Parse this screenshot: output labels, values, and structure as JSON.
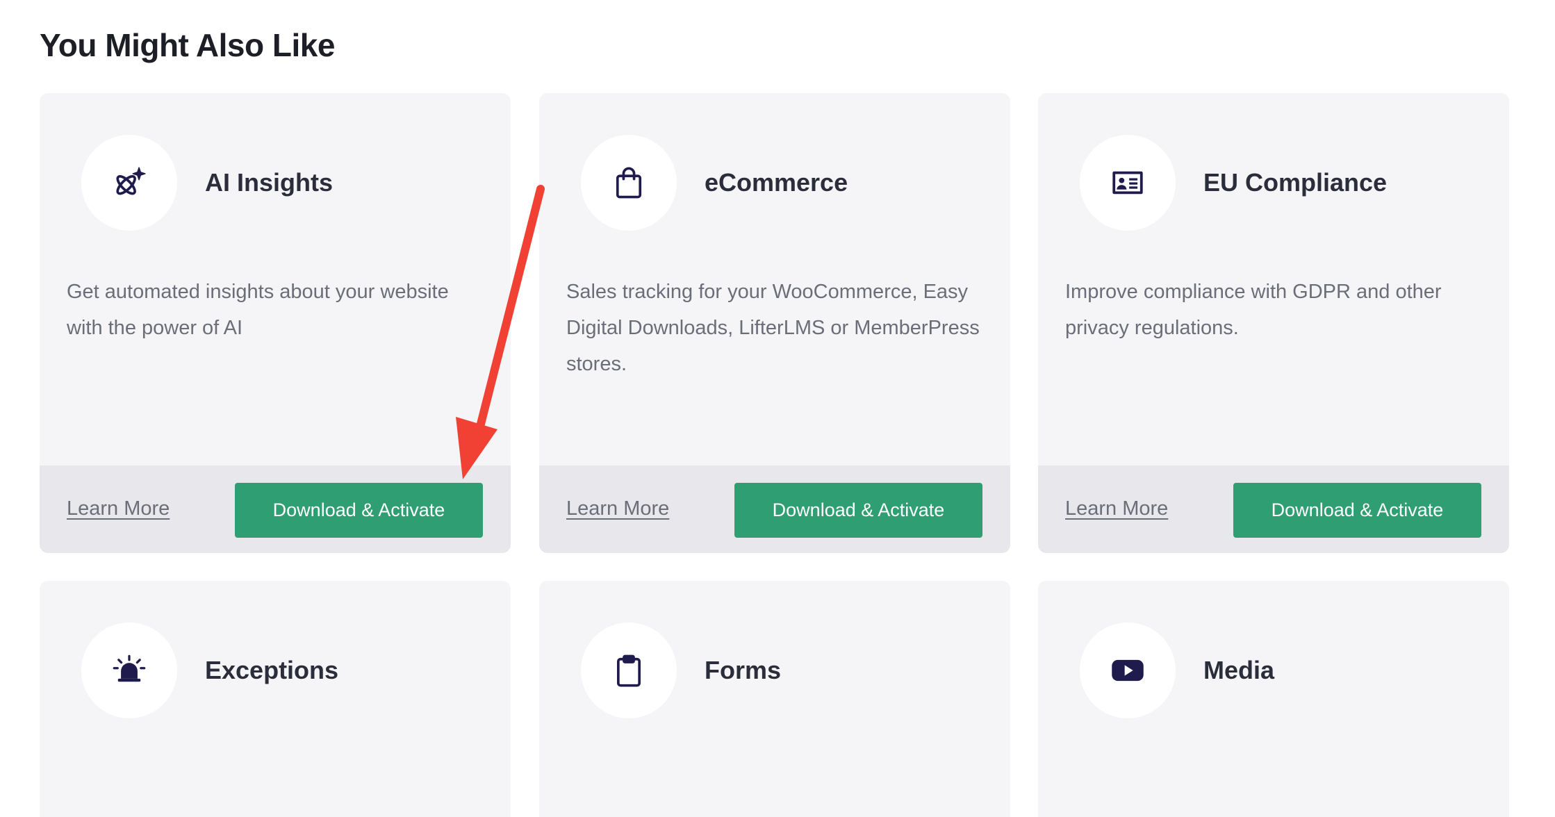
{
  "section": {
    "title": "You Might Also Like"
  },
  "cards": [
    {
      "icon": "ai-sparkle-icon",
      "title": "AI Insights",
      "description": "Get automated insights about your website with the power of AI",
      "learn_more": "Learn More",
      "action": "Download & Activate"
    },
    {
      "icon": "shopping-bag-icon",
      "title": "eCommerce",
      "description": "Sales tracking for your WooCommerce, Easy Digital Downloads, LifterLMS or MemberPress stores.",
      "learn_more": "Learn More",
      "action": "Download & Activate"
    },
    {
      "icon": "id-card-icon",
      "title": "EU Compliance",
      "description": "Improve compliance with GDPR and other privacy regulations.",
      "learn_more": "Learn More",
      "action": "Download & Activate"
    },
    {
      "icon": "alarm-bell-icon",
      "title": "Exceptions"
    },
    {
      "icon": "clipboard-icon",
      "title": "Forms"
    },
    {
      "icon": "video-play-icon",
      "title": "Media"
    }
  ],
  "colors": {
    "accent_button": "#2f9e72",
    "annotation_arrow": "#f04134",
    "icon": "#1f1b4d",
    "card_bg": "#f5f5f8",
    "card_footer_bg": "#e8e8ec"
  }
}
